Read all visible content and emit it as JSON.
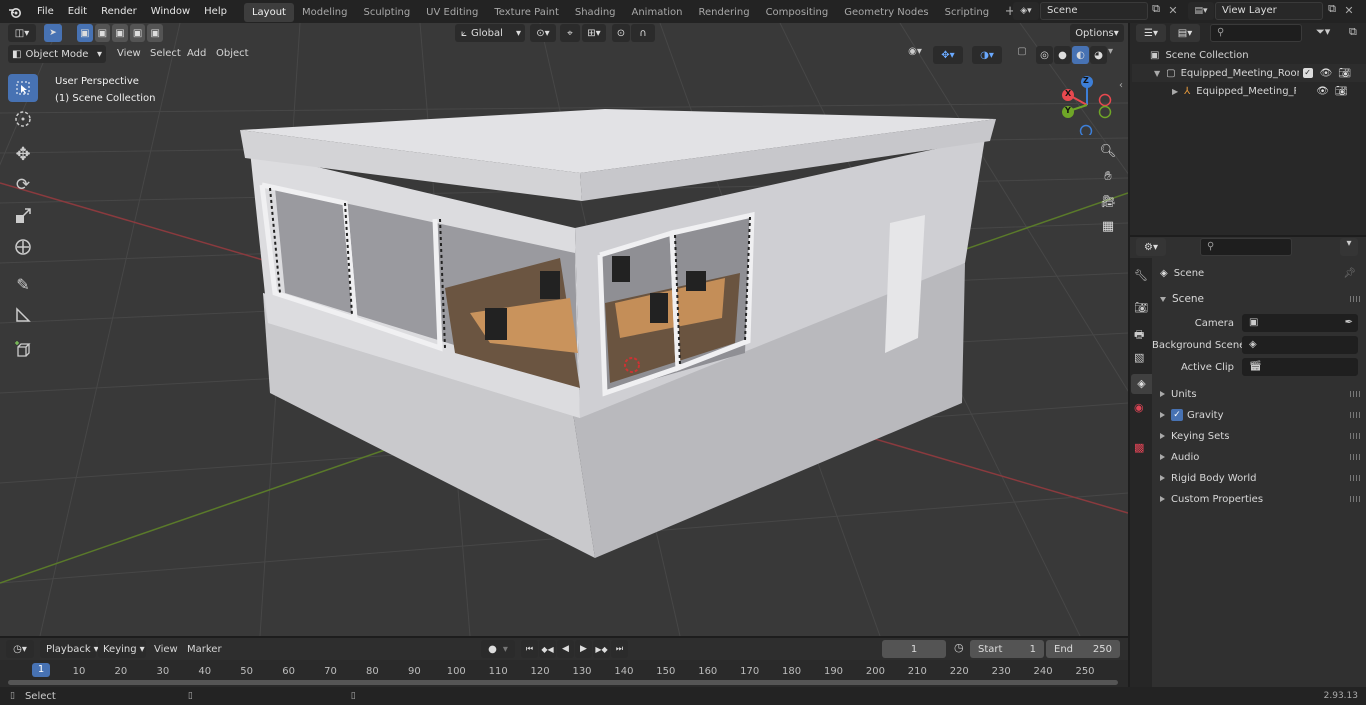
{
  "menu": {
    "file": "File",
    "edit": "Edit",
    "render": "Render",
    "window": "Window",
    "help": "Help"
  },
  "workspaces": [
    "Layout",
    "Modeling",
    "Sculpting",
    "UV Editing",
    "Texture Paint",
    "Shading",
    "Animation",
    "Rendering",
    "Compositing",
    "Geometry Nodes",
    "Scripting"
  ],
  "active_workspace": "Layout",
  "scene_field": "Scene",
  "view_layer_field": "View Layer",
  "viewport_header": {
    "mode": "Object Mode",
    "view": "View",
    "select": "Select",
    "add": "Add",
    "object": "Object",
    "transform_orientation": "Global",
    "options": "Options"
  },
  "viewport_overlay": {
    "perspective": "User Perspective",
    "collection": "(1) Scene Collection"
  },
  "gizmo": {
    "x": "X",
    "y": "Y",
    "z": "Z"
  },
  "outliner": {
    "root": "Scene Collection",
    "items": [
      {
        "label": "Equipped_Meeting_Room_Wh",
        "checked": true
      },
      {
        "label": "Equipped_Meeting_Room"
      }
    ]
  },
  "properties": {
    "context": "Scene",
    "panel": "Scene",
    "camera_label": "Camera",
    "background_scene_label": "Background Scene",
    "active_clip_label": "Active Clip",
    "sections": [
      {
        "label": "Units"
      },
      {
        "label": "Gravity",
        "checkbox": true
      },
      {
        "label": "Keying Sets"
      },
      {
        "label": "Audio"
      },
      {
        "label": "Rigid Body World"
      },
      {
        "label": "Custom Properties"
      }
    ]
  },
  "timeline": {
    "playback": "Playback",
    "keying": "Keying",
    "view": "View",
    "marker": "Marker",
    "current_frame": "1",
    "start_label": "Start",
    "start": "1",
    "end_label": "End",
    "end": "250",
    "ticks": [
      "1",
      "10",
      "20",
      "30",
      "40",
      "50",
      "60",
      "70",
      "80",
      "90",
      "100",
      "110",
      "120",
      "130",
      "140",
      "150",
      "160",
      "170",
      "180",
      "190",
      "200",
      "210",
      "220",
      "230",
      "240",
      "250"
    ]
  },
  "statusbar": {
    "select": "Select",
    "version": "2.93.13"
  },
  "colors": {
    "accent": "#4772b3",
    "axis_x": "#e8494f",
    "axis_y": "#6fa627",
    "axis_z": "#3d7fd8",
    "outliner_icon": "#e89b3d",
    "grid_bg": "#393939"
  }
}
